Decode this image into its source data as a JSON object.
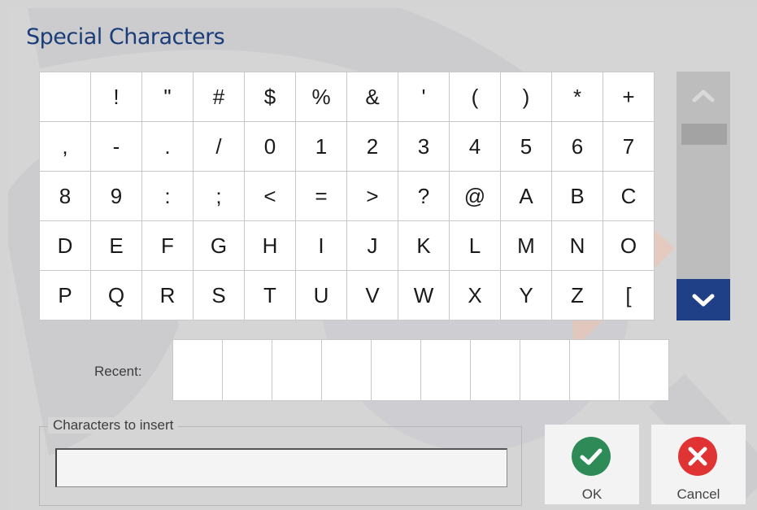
{
  "dialog": {
    "title": "Special Characters"
  },
  "characters": {
    "rows": [
      [
        "",
        "!",
        "\"",
        "#",
        "$",
        "%",
        "&",
        "'",
        "(",
        ")",
        "*",
        "+"
      ],
      [
        ",",
        "-",
        ".",
        "/",
        "0",
        "1",
        "2",
        "3",
        "4",
        "5",
        "6",
        "7"
      ],
      [
        "8",
        "9",
        ":",
        ";",
        "<",
        "=",
        ">",
        "?",
        "@",
        "A",
        "B",
        "C"
      ],
      [
        "D",
        "E",
        "F",
        "G",
        "H",
        "I",
        "J",
        "K",
        "L",
        "M",
        "N",
        "O"
      ],
      [
        "P",
        "Q",
        "R",
        "S",
        "T",
        "U",
        "V",
        "W",
        "X",
        "Y",
        "Z",
        "["
      ]
    ]
  },
  "scrollbar": {
    "up_icon": "chevron-up-icon",
    "down_icon": "chevron-down-icon",
    "accent": "#1f3f87"
  },
  "recent": {
    "label": "Recent:",
    "slots": [
      "",
      "",
      "",
      "",
      "",
      "",
      "",
      "",
      "",
      ""
    ]
  },
  "insert": {
    "legend": "Characters to insert",
    "value": ""
  },
  "buttons": {
    "ok": {
      "label": "OK",
      "icon": "checkmark-icon",
      "color": "#2e8b57"
    },
    "cancel": {
      "label": "Cancel",
      "icon": "close-icon",
      "color": "#e03434"
    }
  },
  "colors": {
    "title": "#1a3c78",
    "background": "#d5d5d5"
  }
}
